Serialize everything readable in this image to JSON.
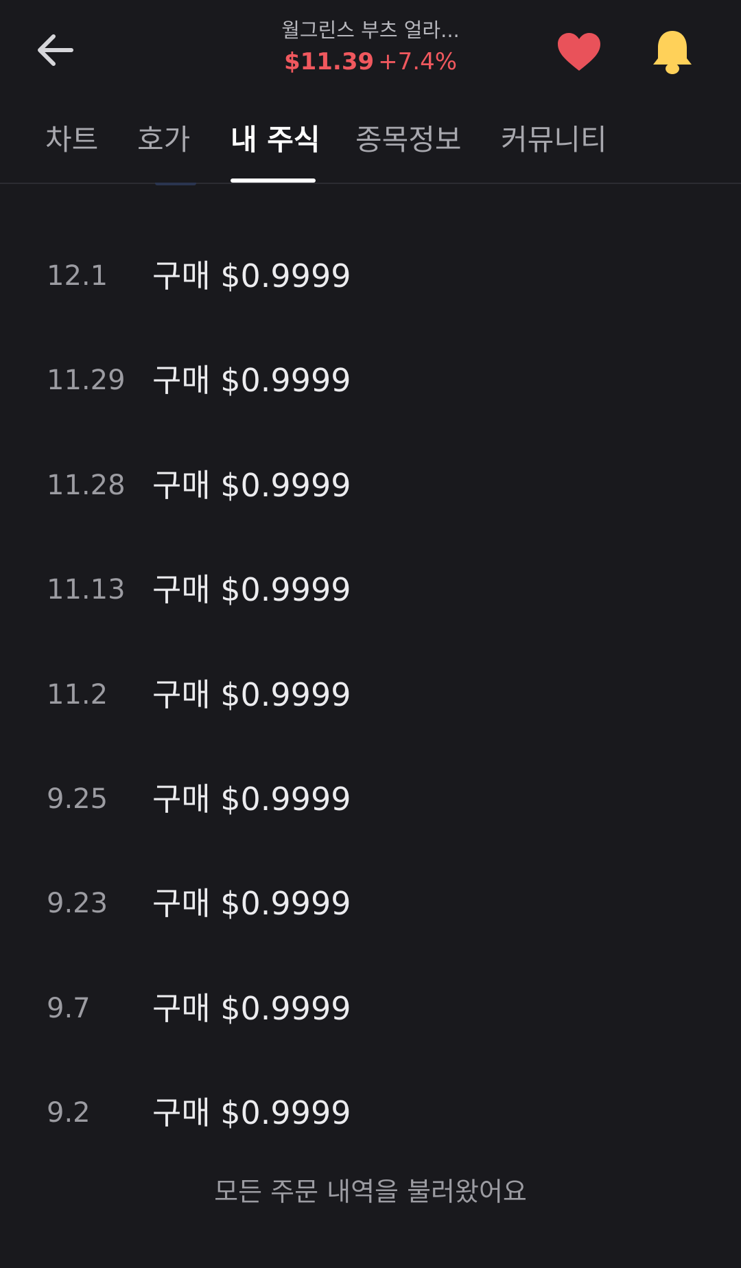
{
  "header": {
    "back_icon": "arrow-left-icon",
    "stock_name": "월그린스 부츠 얼라...",
    "price": "$11.39",
    "change": "+7.4%",
    "price_color": "#f0585e",
    "heart_icon": "heart-icon",
    "heart_color": "#e9525a",
    "bell_icon": "bell-icon",
    "bell_color": "#ffd159"
  },
  "tabs": [
    {
      "label": "차트",
      "active": false
    },
    {
      "label": "호가",
      "active": false
    },
    {
      "label": "내 주식",
      "active": true
    },
    {
      "label": "종목정보",
      "active": false
    },
    {
      "label": "커뮤니티",
      "active": false
    }
  ],
  "orders": [
    {
      "date": "12.1",
      "desc": "구매 $0.9999"
    },
    {
      "date": "11.29",
      "desc": "구매 $0.9999"
    },
    {
      "date": "11.28",
      "desc": "구매 $0.9999"
    },
    {
      "date": "11.13",
      "desc": "구매 $0.9999"
    },
    {
      "date": "11.2",
      "desc": "구매 $0.9999"
    },
    {
      "date": "9.25",
      "desc": "구매 $0.9999"
    },
    {
      "date": "9.23",
      "desc": "구매 $0.9999"
    },
    {
      "date": "9.7",
      "desc": "구매 $0.9999"
    },
    {
      "date": "9.2",
      "desc": "구매 $0.9999"
    }
  ],
  "footer": {
    "message": "모든 주문 내역을 불러왔어요"
  }
}
